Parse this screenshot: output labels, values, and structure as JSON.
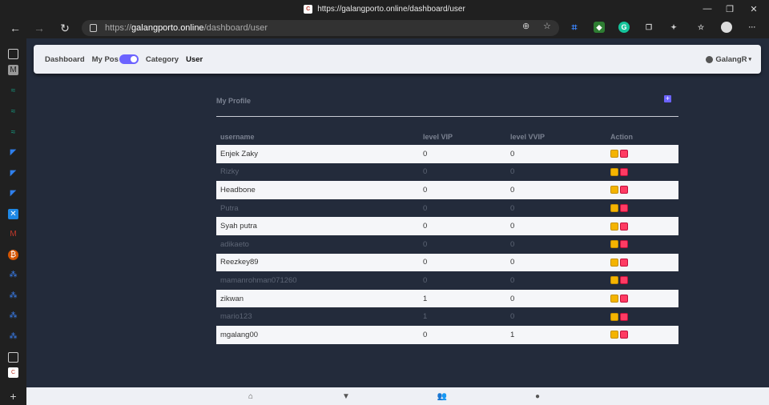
{
  "browser": {
    "window_title": "https://galangporto.online/dashboard/user",
    "url_domain": "galangporto.online",
    "url_prefix": "https://",
    "url_path": "/dashboard/user"
  },
  "nav": {
    "dashboard": "Dashboard",
    "my_pos": "My Pos",
    "category": "Category",
    "user": "User",
    "account": "GalangR",
    "account_caret": "▾"
  },
  "profile": {
    "title": "My Profile",
    "add_icon": "+"
  },
  "table": {
    "headers": [
      "username",
      "level VIP",
      "level VVIP",
      "Action"
    ],
    "rows": [
      {
        "username": "Enjek Zaky",
        "vip": "0",
        "vvip": "0"
      },
      {
        "username": "Rizky",
        "vip": "0",
        "vvip": "0"
      },
      {
        "username": "Headbone",
        "vip": "0",
        "vvip": "0"
      },
      {
        "username": "Putra",
        "vip": "0",
        "vvip": "0"
      },
      {
        "username": "Syah putra",
        "vip": "0",
        "vvip": "0"
      },
      {
        "username": "adikaeto",
        "vip": "0",
        "vvip": "0"
      },
      {
        "username": "Reezkey89",
        "vip": "0",
        "vvip": "0"
      },
      {
        "username": "mamanrohman071260",
        "vip": "0",
        "vvip": "0"
      },
      {
        "username": "zikwan",
        "vip": "1",
        "vvip": "0"
      },
      {
        "username": "mario123",
        "vip": "1",
        "vvip": "0"
      },
      {
        "username": "mgalang00",
        "vip": "0",
        "vvip": "1"
      }
    ]
  },
  "colors": {
    "accent": "#6c63ff",
    "edit": "#f4b400",
    "delete": "#ff3b63",
    "page_bg": "#232b3b"
  }
}
